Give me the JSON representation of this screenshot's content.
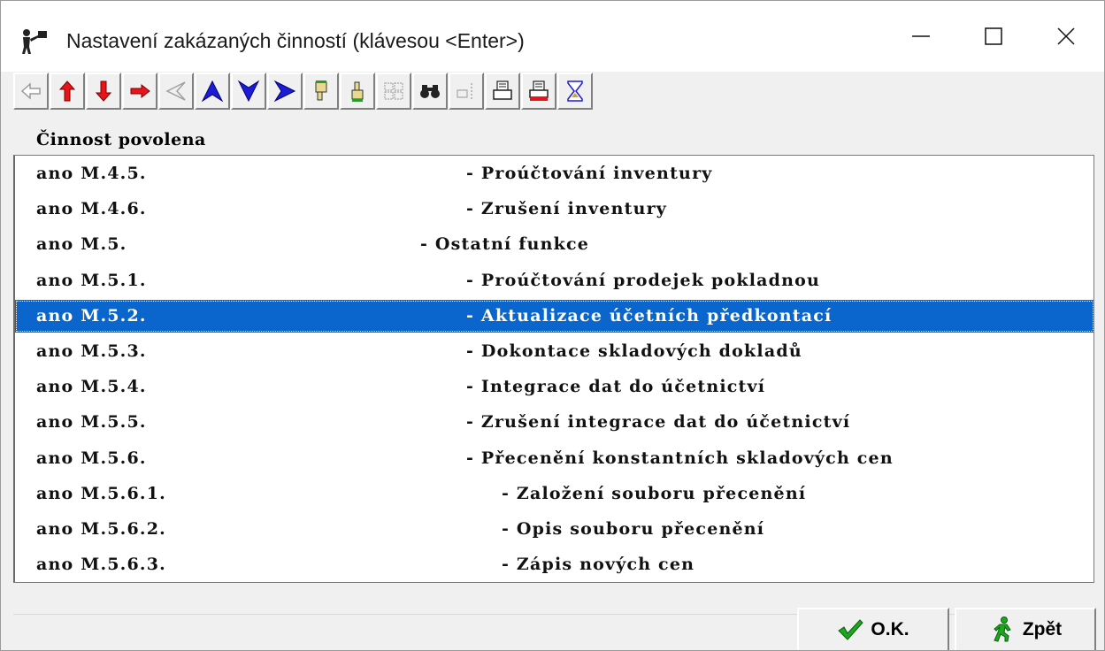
{
  "window": {
    "title": "Nastavení zakázaných činností (klávesou <Enter>)"
  },
  "toolbar": {
    "buttons": [
      {
        "icon": "arrow-left-disabled-icon"
      },
      {
        "icon": "arrow-up-red-icon"
      },
      {
        "icon": "arrow-down-red-icon"
      },
      {
        "icon": "arrow-right-red-icon"
      },
      {
        "icon": "arrow-left-outline-disabled-icon"
      },
      {
        "icon": "arrow-top-blue-icon"
      },
      {
        "icon": "arrow-bottom-blue-icon"
      },
      {
        "icon": "arrow-forward-blue-icon"
      },
      {
        "icon": "hand-pointing-down-icon"
      },
      {
        "icon": "hand-pointing-up-icon"
      },
      {
        "icon": "filter-disabled-icon"
      },
      {
        "icon": "binoculars-icon"
      },
      {
        "icon": "hand-select-disabled-icon"
      },
      {
        "icon": "printer-icon"
      },
      {
        "icon": "printer-red-icon"
      },
      {
        "icon": "hourglass-icon"
      }
    ]
  },
  "grid": {
    "header": "Činnost povolena",
    "rows": [
      {
        "col1": "ano M.4.5.",
        "col2": "- Proúčtování inventury",
        "indent": 2
      },
      {
        "col1": "ano M.4.6.",
        "col2": "- Zrušení inventury",
        "indent": 2
      },
      {
        "col1": "ano M.5.",
        "col2": "- Ostatní funkce",
        "indent": 1
      },
      {
        "col1": "ano M.5.1.",
        "col2": "- Proúčtování prodejek pokladnou",
        "indent": 2
      },
      {
        "col1": "ano M.5.2.",
        "col2": "- Aktualizace účetních předkontací",
        "indent": 2,
        "selected": true
      },
      {
        "col1": "ano M.5.3.",
        "col2": "- Dokontace skladových dokladů",
        "indent": 2
      },
      {
        "col1": "ano M.5.4.",
        "col2": "- Integrace dat do účetnictví",
        "indent": 2
      },
      {
        "col1": "ano M.5.5.",
        "col2": "- Zrušení integrace dat do účetnictví",
        "indent": 2
      },
      {
        "col1": "ano M.5.6.",
        "col2": "- Přecenění konstantních skladových cen",
        "indent": 2
      },
      {
        "col1": "ano M.5.6.1.",
        "col2": "- Založení souboru přecenění",
        "indent": 3
      },
      {
        "col1": "ano M.5.6.2.",
        "col2": "- Opis souboru přecenění",
        "indent": 3
      },
      {
        "col1": "ano M.5.6.3.",
        "col2": "- Zápis nových cen",
        "indent": 3
      }
    ]
  },
  "buttons": {
    "ok_label": "O.K.",
    "back_label": "Zpět"
  },
  "colors": {
    "selection": "#0a66cc",
    "ok_check": "#1fa51f",
    "back_figure": "#1fa51f"
  }
}
